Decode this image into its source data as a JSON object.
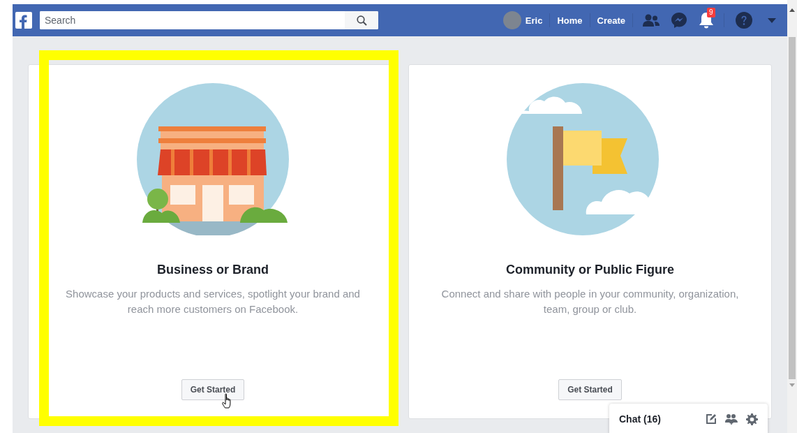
{
  "topbar": {
    "search": {
      "placeholder": "Search"
    },
    "profile_name": "Eric",
    "nav": [
      "Home",
      "Create"
    ],
    "notification_count": "9"
  },
  "cards": [
    {
      "kind": "business",
      "title": "Business or Brand",
      "description": "Showcase your products and services, spotlight your brand and reach more customers on Facebook.",
      "button": "Get Started",
      "highlighted": true,
      "hovered": true
    },
    {
      "kind": "community",
      "title": "Community or Public Figure",
      "description": "Connect and share with people in your community, organization, team, group or club.",
      "button": "Get Started",
      "highlighted": false,
      "hovered": false
    }
  ],
  "chat": {
    "label": "Chat (16)"
  }
}
